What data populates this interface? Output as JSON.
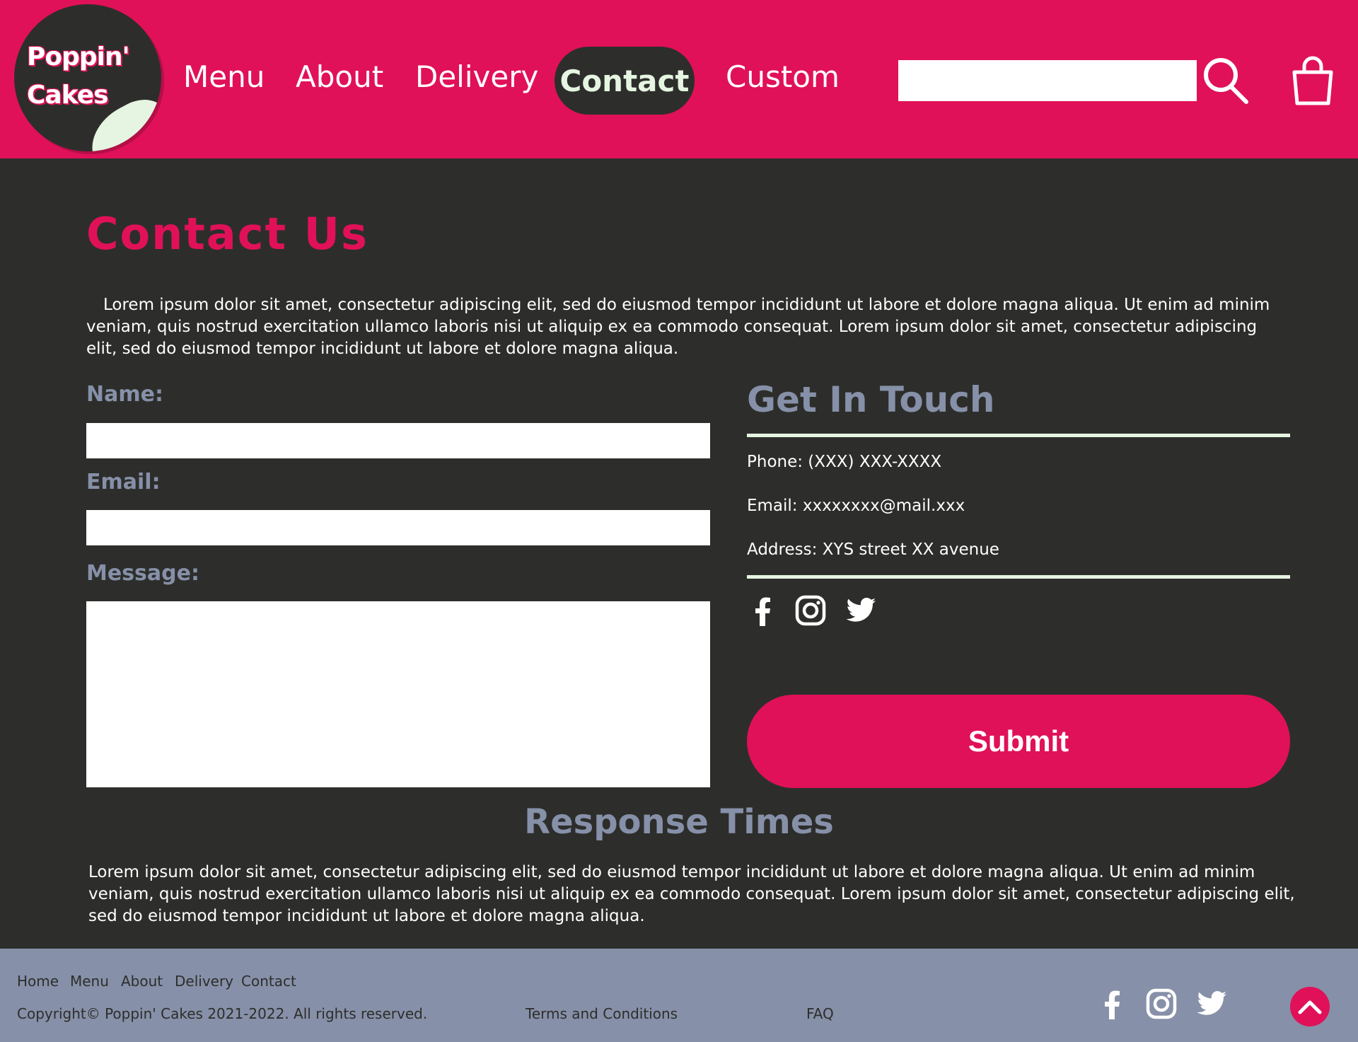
{
  "brand": {
    "line1": "Poppin'",
    "line2": "Cakes"
  },
  "nav": {
    "menu": "Menu",
    "about": "About",
    "delivery": "Delivery",
    "contact": "Contact",
    "custom": "Custom"
  },
  "search": {
    "placeholder": "",
    "value": ""
  },
  "page": {
    "title": "Contact Us",
    "intro": "Lorem ipsum dolor sit amet, consectetur adipiscing elit, sed do eiusmod tempor incididunt ut labore et dolore magna aliqua. Ut enim ad minim veniam, quis nostrud exercitation ullamco laboris nisi ut aliquip ex ea commodo consequat.  Lorem ipsum dolor sit amet, consectetur adipiscing elit, sed do eiusmod tempor incididunt ut labore et dolore magna aliqua."
  },
  "form": {
    "name_label": "Name:",
    "email_label": "Email:",
    "message_label": "Message:",
    "name_value": "",
    "email_value": "",
    "message_value": "",
    "submit_label": "Submit"
  },
  "get_in_touch": {
    "title": "Get In Touch",
    "phone": "Phone: (XXX) XXX-XXXX",
    "email": "Email: xxxxxxxx@mail.xxx",
    "address": "Address: XYS street XX avenue"
  },
  "social_icons": [
    "facebook-icon",
    "instagram-icon",
    "twitter-icon"
  ],
  "response": {
    "title": "Response Times",
    "text": "Lorem ipsum dolor sit amet, consectetur adipiscing elit, sed do eiusmod tempor incididunt ut labore et dolore magna aliqua. Ut enim ad minim veniam, quis nostrud exercitation ullamco laboris nisi ut aliquip ex ea commodo consequat. Lorem ipsum dolor sit amet, consectetur adipiscing elit, sed do eiusmod tempor incididunt ut labore et dolore magna aliqua."
  },
  "footer": {
    "links": {
      "home": "Home",
      "menu": "Menu",
      "about": "About",
      "delivery": "Delivery",
      "contact": "Contact"
    },
    "copyright": "Copyright© Poppin' Cakes 2021-2022. All rights reserved.",
    "terms": "Terms and Conditions",
    "faq": "FAQ"
  },
  "colors": {
    "brand_pink": "#e01158",
    "dark_bg": "#2d2e2b",
    "muted_blue": "#8690a8",
    "mint": "#e6f4e2"
  }
}
